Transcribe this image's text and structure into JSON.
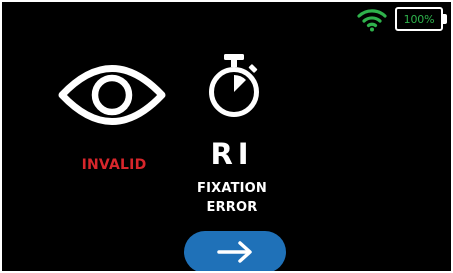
{
  "status_bar": {
    "wifi_icon": "wifi-icon",
    "battery_icon": "battery-icon",
    "battery_level": "100%"
  },
  "result": {
    "icon": "eye-icon",
    "status": "INVALID"
  },
  "test": {
    "icon": "stopwatch-icon",
    "code": "RI",
    "message_line1": "FIXATION",
    "message_line2": "ERROR"
  },
  "next_button": {
    "icon": "arrow-right-icon"
  },
  "colors": {
    "background": "#000000",
    "invalid": "#d8262b",
    "wifi": "#2fb24c",
    "button": "#1f71b8",
    "text": "#ffffff"
  }
}
